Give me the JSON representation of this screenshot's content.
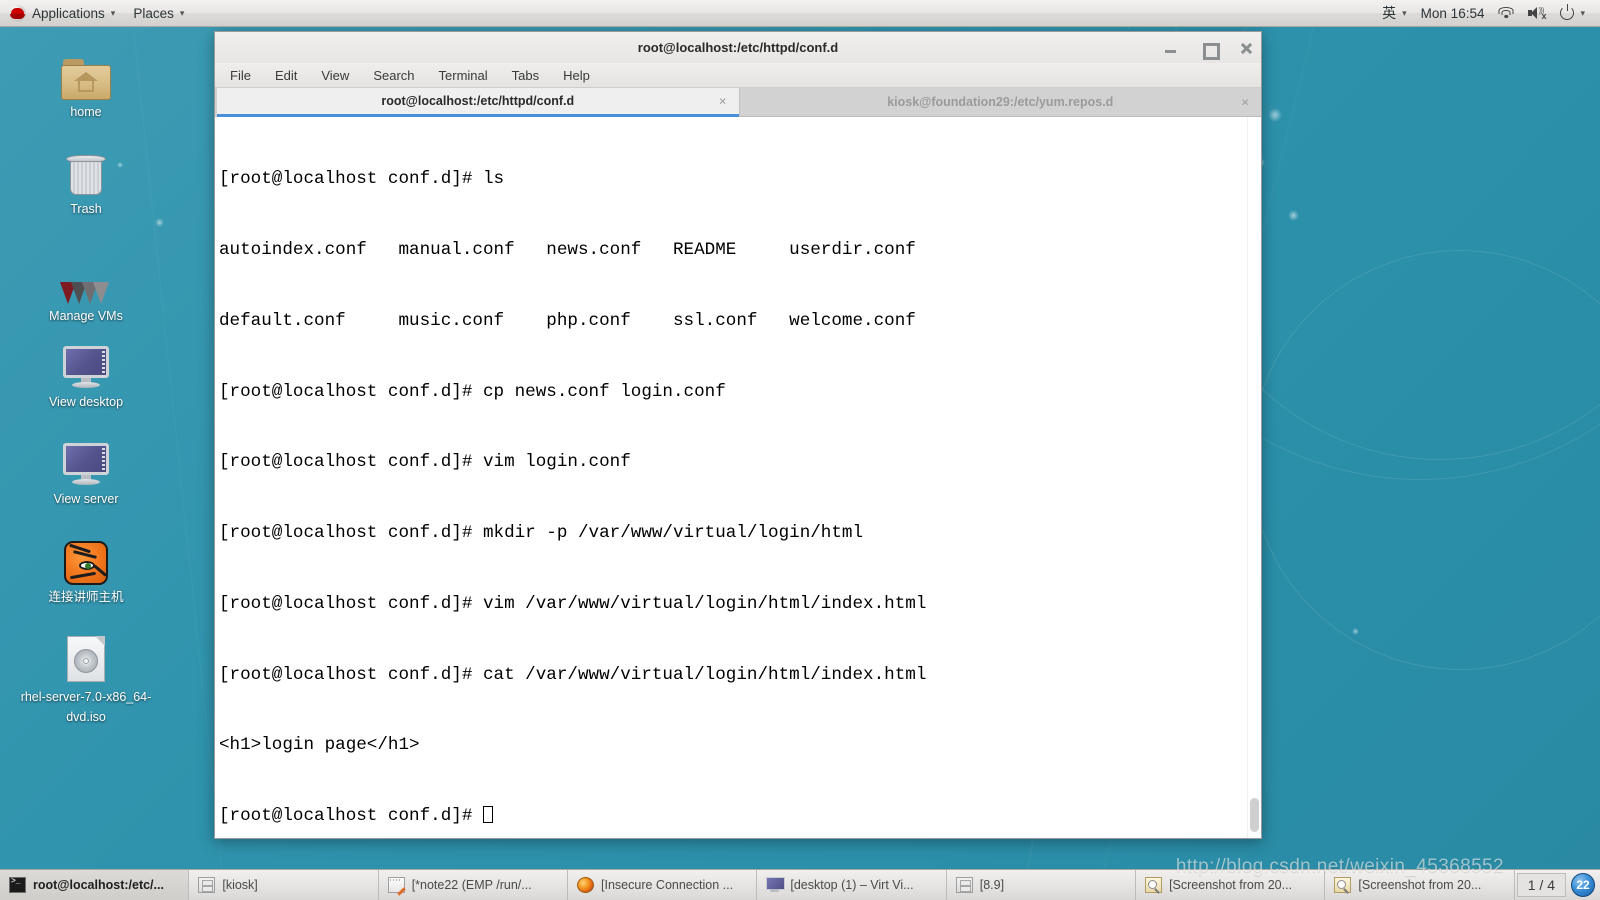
{
  "top_panel": {
    "logo_icon": "redhat-logo-icon",
    "applications_label": "Applications",
    "places_label": "Places",
    "caret": "▾",
    "ime_label": "英",
    "clock": "Mon 16:54",
    "wifi_icon": "wifi-icon",
    "volume_icon": "volume-muted-icon",
    "power_icon": "power-icon",
    "tray_caret": "▾"
  },
  "desktop_icons": [
    {
      "label": "home",
      "icon": "home-folder-icon"
    },
    {
      "label": "Trash",
      "icon": "trash-icon"
    },
    {
      "label": "Manage VMs",
      "icon": "vmware-icon"
    },
    {
      "label": "View desktop",
      "icon": "monitor-icon"
    },
    {
      "label": "View server",
      "icon": "monitor-icon"
    },
    {
      "label": "连接讲师主机",
      "icon": "tiger-icon"
    },
    {
      "label": "rhel-server-7.0-x86_64-dvd.iso",
      "icon": "iso-disc-icon"
    }
  ],
  "terminal": {
    "title": "root@localhost:/etc/httpd/conf.d",
    "window_buttons": {
      "minimize": "minimize-icon",
      "maximize": "maximize-icon",
      "close": "close-icon"
    },
    "menu": [
      "File",
      "Edit",
      "View",
      "Search",
      "Terminal",
      "Tabs",
      "Help"
    ],
    "tabs": [
      {
        "label": "root@localhost:/etc/httpd/conf.d",
        "active": true,
        "close": "×"
      },
      {
        "label": "kiosk@foundation29:/etc/yum.repos.d",
        "active": false,
        "close": "×"
      }
    ],
    "prompt": "[root@localhost conf.d]# ",
    "lines": [
      "[root@localhost conf.d]# ls",
      "autoindex.conf   manual.conf   news.conf   README     userdir.conf",
      "default.conf     music.conf    php.conf    ssl.conf   welcome.conf",
      "[root@localhost conf.d]# cp news.conf login.conf",
      "[root@localhost conf.d]# vim login.conf",
      "[root@localhost conf.d]# mkdir -p /var/www/virtual/login/html",
      "[root@localhost conf.d]# vim /var/www/virtual/login/html/index.html",
      "[root@localhost conf.d]# cat /var/www/virtual/login/html/index.html",
      "<h1>login page</h1>"
    ],
    "last_prompt": "[root@localhost conf.d]# ",
    "cursor": "block-cursor"
  },
  "taskbar": {
    "buttons": [
      {
        "label": "root@localhost:/etc/...",
        "icon": "terminal-icon",
        "active": true
      },
      {
        "label": "[kiosk]",
        "icon": "archive-icon",
        "active": false
      },
      {
        "label": "[*note22 (EMP /run/...",
        "icon": "notepad-icon",
        "active": false
      },
      {
        "label": "[Insecure Connection ...",
        "icon": "firefox-icon",
        "active": false
      },
      {
        "label": "[desktop (1) – Virt Vi...",
        "icon": "monitor-icon",
        "active": false
      },
      {
        "label": "[8.9]",
        "icon": "archive-icon",
        "active": false
      },
      {
        "label": "[Screenshot from 20...",
        "icon": "screenshot-icon",
        "active": false
      },
      {
        "label": "[Screenshot from 20...",
        "icon": "screenshot-icon",
        "active": false
      }
    ],
    "workspace": "1 / 4",
    "tray_badge": "22"
  },
  "watermark": "http://blog.csdn.net/weixin_45368552",
  "colors": {
    "desktop": "#2f93ad",
    "accent": "#4a90d9",
    "panel": "#e6e5e3",
    "terminal_bg": "#ffffff",
    "terminal_fg": "#000000"
  }
}
